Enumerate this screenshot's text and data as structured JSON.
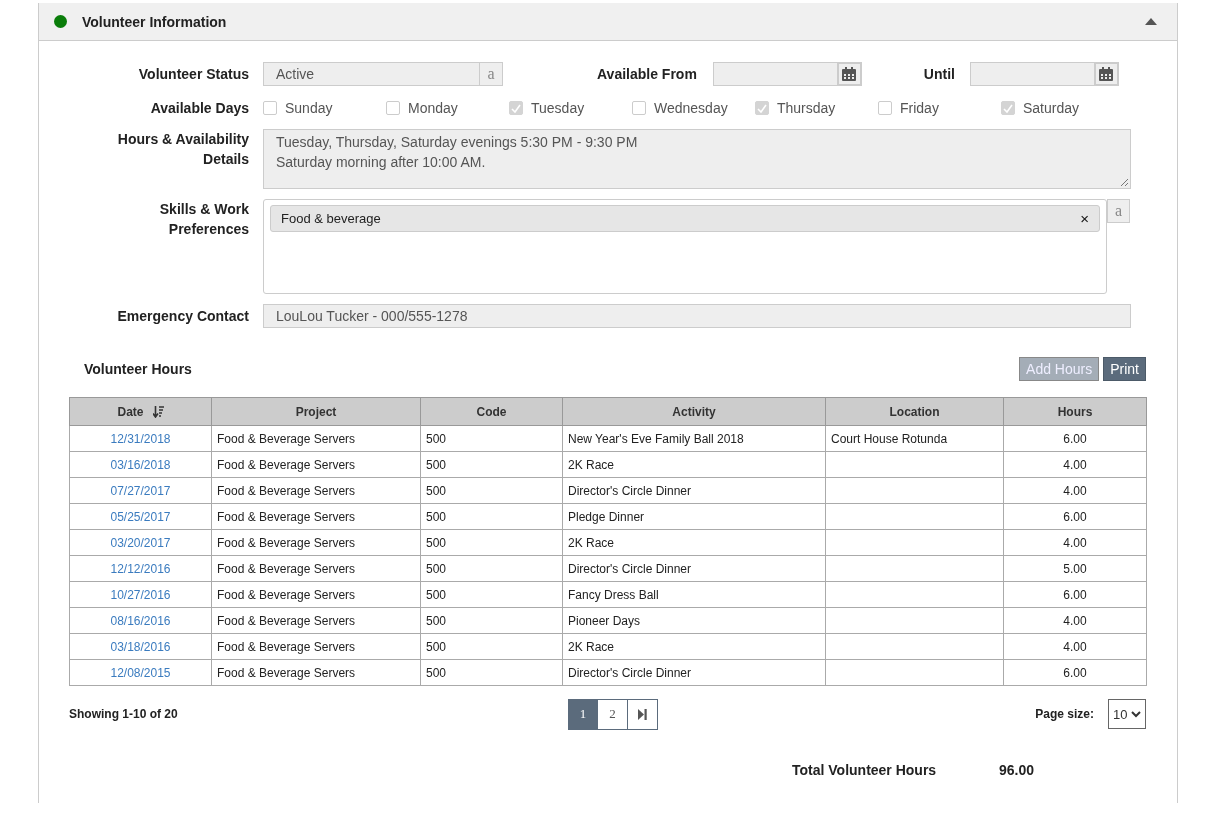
{
  "panel": {
    "title": "Volunteer Information"
  },
  "form": {
    "status_label": "Volunteer Status",
    "status_value": "Active",
    "status_addon": "a",
    "available_from_label": "Available From",
    "until_label": "Until",
    "days_label": "Available Days",
    "days": [
      {
        "label": "Sunday",
        "checked": false
      },
      {
        "label": "Monday",
        "checked": false
      },
      {
        "label": "Tuesday",
        "checked": true
      },
      {
        "label": "Wednesday",
        "checked": false
      },
      {
        "label": "Thursday",
        "checked": true
      },
      {
        "label": "Friday",
        "checked": false
      },
      {
        "label": "Saturday",
        "checked": true
      }
    ],
    "details_label": "Hours & Availability Details",
    "details_lines": [
      "Tuesday, Thursday, Saturday evenings 5:30 PM - 9:30 PM",
      "Saturday morning after 10:00 AM."
    ],
    "skills_label": "Skills & Work Preferences",
    "skills": [
      "Food & beverage"
    ],
    "skills_remove": "×",
    "skills_addon": "a",
    "emergency_label": "Emergency Contact",
    "emergency_value": "LouLou Tucker - 000/555-1278"
  },
  "hours": {
    "title": "Volunteer Hours",
    "buttons": [
      {
        "label": "Add Hours",
        "disabled": true
      },
      {
        "label": "Print",
        "disabled": false
      }
    ],
    "columns": [
      "Date",
      "Project",
      "Code",
      "Activity",
      "Location",
      "Hours"
    ],
    "rows": [
      [
        "12/31/2018",
        "Food & Beverage Servers",
        "500",
        "New Year's Eve Family Ball 2018",
        "Court House Rotunda",
        "6.00"
      ],
      [
        "03/16/2018",
        "Food & Beverage Servers",
        "500",
        "2K Race",
        "",
        "4.00"
      ],
      [
        "07/27/2017",
        "Food & Beverage Servers",
        "500",
        "Director's Circle Dinner",
        "",
        "4.00"
      ],
      [
        "05/25/2017",
        "Food & Beverage Servers",
        "500",
        "Pledge Dinner",
        "",
        "6.00"
      ],
      [
        "03/20/2017",
        "Food & Beverage Servers",
        "500",
        "2K Race",
        "",
        "4.00"
      ],
      [
        "12/12/2016",
        "Food & Beverage Servers",
        "500",
        "Director's Circle Dinner",
        "",
        "5.00"
      ],
      [
        "10/27/2016",
        "Food & Beverage Servers",
        "500",
        "Fancy Dress Ball",
        "",
        "6.00"
      ],
      [
        "08/16/2016",
        "Food & Beverage Servers",
        "500",
        "Pioneer Days",
        "",
        "4.00"
      ],
      [
        "03/18/2016",
        "Food & Beverage Servers",
        "500",
        "2K Race",
        "",
        "4.00"
      ],
      [
        "12/08/2015",
        "Food & Beverage Servers",
        "500",
        "Director's Circle Dinner",
        "",
        "6.00"
      ]
    ],
    "showing": "Showing 1-10 of 20",
    "pages": [
      {
        "label": "1",
        "selected": true
      },
      {
        "label": "2",
        "selected": false
      }
    ],
    "page_size_label": "Page size:",
    "page_size": "10",
    "total_label": "Total Volunteer Hours",
    "total_value": "96.00"
  }
}
